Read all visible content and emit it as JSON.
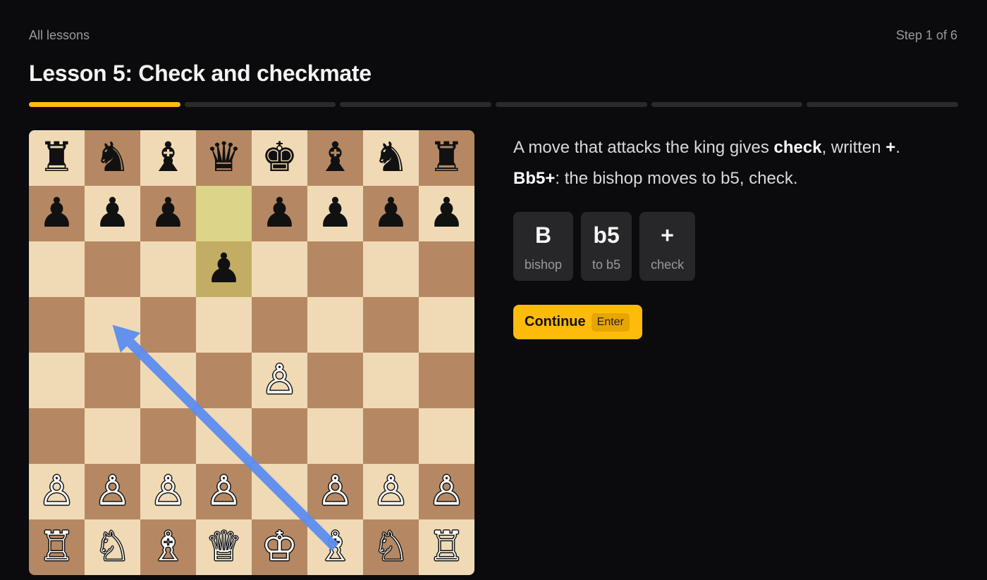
{
  "nav": {
    "back_label": "All lessons",
    "step_label": "Step 1 of 6"
  },
  "lesson": {
    "title": "Lesson 5: Check and checkmate"
  },
  "progress": {
    "total_steps": 6,
    "current_step": 1
  },
  "board": {
    "light_color": "#f0dab5",
    "dark_color": "#b58863",
    "highlight_squares": [
      "d7",
      "d6"
    ],
    "arrow": {
      "from": "f1",
      "to": "b5",
      "color": "#5b8def"
    },
    "ranks": [
      [
        "♜",
        "♞",
        "♝",
        "♛",
        "♚",
        "♝",
        "♞",
        "♜"
      ],
      [
        "♟",
        "♟",
        "♟",
        "",
        "♟",
        "♟",
        "♟",
        "♟"
      ],
      [
        "",
        "",
        "",
        "♟",
        "",
        "",
        "",
        ""
      ],
      [
        "",
        "",
        "",
        "",
        "",
        "",
        "",
        ""
      ],
      [
        "",
        "",
        "",
        "",
        "♙",
        "",
        "",
        ""
      ],
      [
        "",
        "",
        "",
        "",
        "",
        "",
        "",
        ""
      ],
      [
        "♙",
        "♙",
        "♙",
        "♙",
        "",
        "♙",
        "♙",
        "♙"
      ],
      [
        "♖",
        "♘",
        "♗",
        "♕",
        "♔",
        "♗",
        "♘",
        "♖"
      ]
    ]
  },
  "description": {
    "line1_prefix": "A move that attacks the king gives ",
    "line1_bold": "check",
    "line1_mid": ", written ",
    "line1_bold2": "+",
    "line1_end": ".",
    "line2_bold": "Bb5+",
    "line2_rest": ": the bishop moves to b5, check."
  },
  "tokens": [
    {
      "symbol": "B",
      "label": "bishop"
    },
    {
      "symbol": "b5",
      "label": "to b5"
    },
    {
      "symbol": "+",
      "label": "check"
    }
  ],
  "continue_button": {
    "label": "Continue",
    "shortcut": "Enter",
    "color": "#ffbb0c"
  }
}
